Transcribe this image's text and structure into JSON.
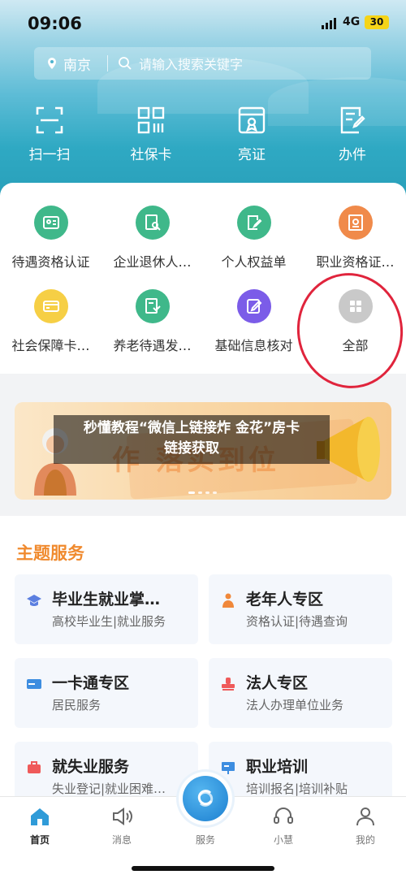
{
  "status": {
    "time": "09:06",
    "network": "4G",
    "battery": "30"
  },
  "search": {
    "city": "南京",
    "placeholder": "请输入搜索关键字"
  },
  "quick_actions": [
    {
      "label": "扫一扫",
      "icon": "scan-icon"
    },
    {
      "label": "社保卡",
      "icon": "qr-card-icon"
    },
    {
      "label": "亮证",
      "icon": "certificate-icon"
    },
    {
      "label": "办件",
      "icon": "document-edit-icon"
    }
  ],
  "services": [
    {
      "label": "待遇资格认证",
      "icon": "id-card-icon",
      "color": "#3fb88a"
    },
    {
      "label": "企业退休人…",
      "icon": "search-doc-icon",
      "color": "#3fb88a"
    },
    {
      "label": "个人权益单",
      "icon": "doc-edit-icon",
      "color": "#3fb88a"
    },
    {
      "label": "职业资格证…",
      "icon": "certificate-doc-icon",
      "color": "#f08a4a"
    },
    {
      "label": "社会保障卡…",
      "icon": "card-icon",
      "color": "#f6cf45"
    },
    {
      "label": "养老待遇发…",
      "icon": "pension-doc-icon",
      "color": "#3fb88a"
    },
    {
      "label": "基础信息核对",
      "icon": "edit-icon",
      "color": "#7b5ce8"
    },
    {
      "label": "全部",
      "icon": "grid-icon",
      "color": "#c9c9c9"
    }
  ],
  "banner": {
    "overlay_line1": "秒懂教程“微信上链接炸 金花”房卡",
    "overlay_line2": "链接获取",
    "art_text": "作 落实到位"
  },
  "section_title": "主题服务",
  "themes": [
    {
      "title": "毕业生就业掌…",
      "subtitle": "高校毕业生|就业服务",
      "icon": "graduate-icon",
      "color": "#5b7fe0"
    },
    {
      "title": "老年人专区",
      "subtitle": "资格认证|待遇查询",
      "icon": "elder-icon",
      "color": "#f0883a"
    },
    {
      "title": "一卡通专区",
      "subtitle": "居民服务",
      "icon": "card-icon",
      "color": "#3d8de0"
    },
    {
      "title": "法人专区",
      "subtitle": "法人办理单位业务",
      "icon": "stamp-icon",
      "color": "#ef5a5a"
    },
    {
      "title": "就失业服务",
      "subtitle": "失业登记|就业困难…",
      "icon": "briefcase-icon",
      "color": "#ef5a5a"
    },
    {
      "title": "职业培训",
      "subtitle": "培训报名|培训补贴",
      "icon": "training-icon",
      "color": "#3d8de0"
    }
  ],
  "tabs": [
    {
      "label": "首页",
      "icon": "home-icon",
      "active": true
    },
    {
      "label": "消息",
      "icon": "speaker-icon",
      "active": false
    },
    {
      "label": "服务",
      "icon": "service-logo-icon",
      "active": false
    },
    {
      "label": "小慧",
      "icon": "headset-icon",
      "active": false
    },
    {
      "label": "我的",
      "icon": "user-icon",
      "active": false
    }
  ],
  "colors": {
    "accent_orange": "#f08a2e",
    "annotation_red": "#e0243c",
    "hero_teal": "#2fa9c3"
  }
}
